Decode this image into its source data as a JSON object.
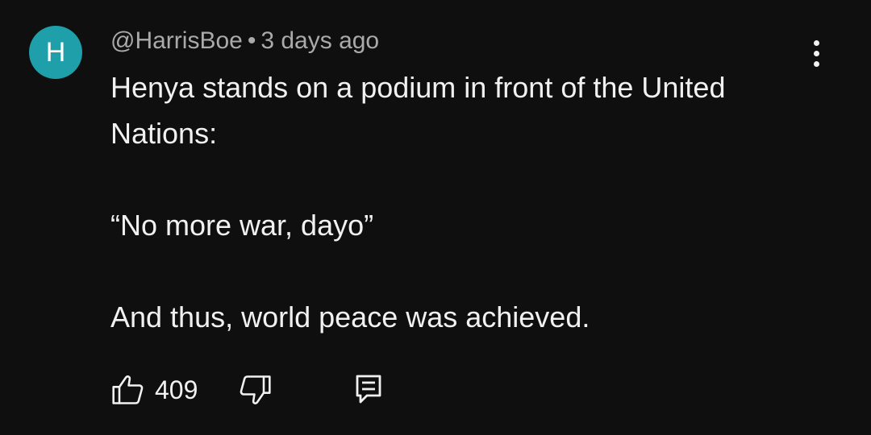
{
  "comment": {
    "avatar_letter": "H",
    "avatar_color": "#1e9fa9",
    "author": "@HarrisBoe",
    "separator": "•",
    "timestamp": "3 days ago",
    "lines": [
      "Henya stands on a podium in front of the United Nations:",
      "“No more war, dayo”",
      "And thus, world peace was achieved."
    ],
    "like_count": "409",
    "icons": {
      "menu": "more-vertical-icon",
      "like": "thumbs-up-icon",
      "dislike": "thumbs-down-icon",
      "reply": "reply-comment-icon"
    }
  }
}
